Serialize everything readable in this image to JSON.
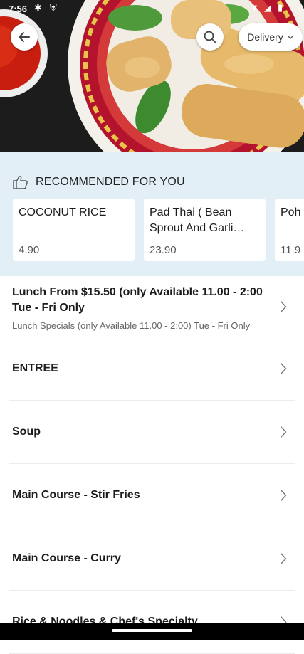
{
  "status_bar": {
    "time": "7:56"
  },
  "header": {
    "delivery_label": "Delivery"
  },
  "recommended": {
    "title": "RECOMMENDED FOR YOU",
    "items": [
      {
        "name": "COCONUT RICE",
        "price": "4.90"
      },
      {
        "name": "Pad Thai ( Bean Sprout And Garli…",
        "price": "23.90"
      },
      {
        "name": "Poh Hom",
        "price": "11.9"
      }
    ]
  },
  "categories": [
    {
      "title": "Lunch From $15.50 (only Available 11.00 - 2:00 Tue - Fri Only",
      "subtitle": "Lunch Specials (only Available 11.00 - 2:00) Tue - Fri Only"
    },
    {
      "title": "ENTREE"
    },
    {
      "title": "Soup"
    },
    {
      "title": "Main Course - Stir Fries"
    },
    {
      "title": "Main Course - Curry"
    },
    {
      "title": "Rice & Noodles & Chef's Specialty"
    }
  ],
  "colors": {
    "accent_bg": "#e3eff6",
    "chevron": "#777777"
  }
}
